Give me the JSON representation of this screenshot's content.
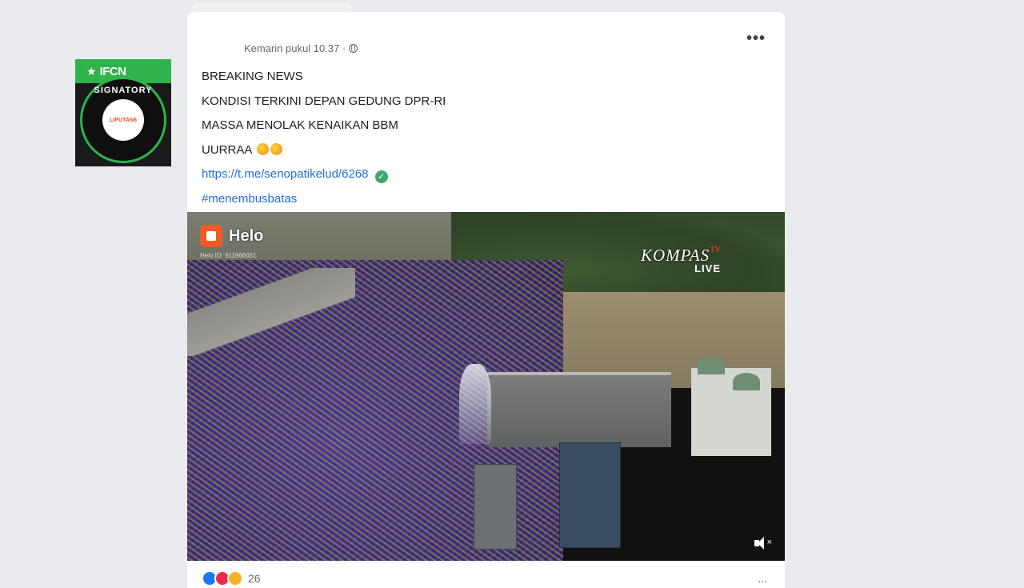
{
  "badge": {
    "brand": "IFCN",
    "ring_text": "SIGNATORY",
    "center_text": "LIPUTAN6"
  },
  "post": {
    "timestamp": "Kemarin pukul 10.37 ·",
    "lines": [
      "BREAKING NEWS",
      "KONDISI TERKINI DEPAN GEDUNG DPR-RI",
      "MASSA MENOLAK KENAIKAN BBM",
      "UURRAA"
    ],
    "link": "https://t.me/senopatikelud/6268",
    "hashtag": "#menembusbatas"
  },
  "video": {
    "app_name": "Helo",
    "app_id": "Helo ID: 911966051",
    "broadcaster": "KOMPAS",
    "broadcaster_suffix": "TV",
    "broadcaster_live": "LIVE"
  },
  "footer": {
    "reaction_count": "26",
    "comments_summary": "..."
  }
}
